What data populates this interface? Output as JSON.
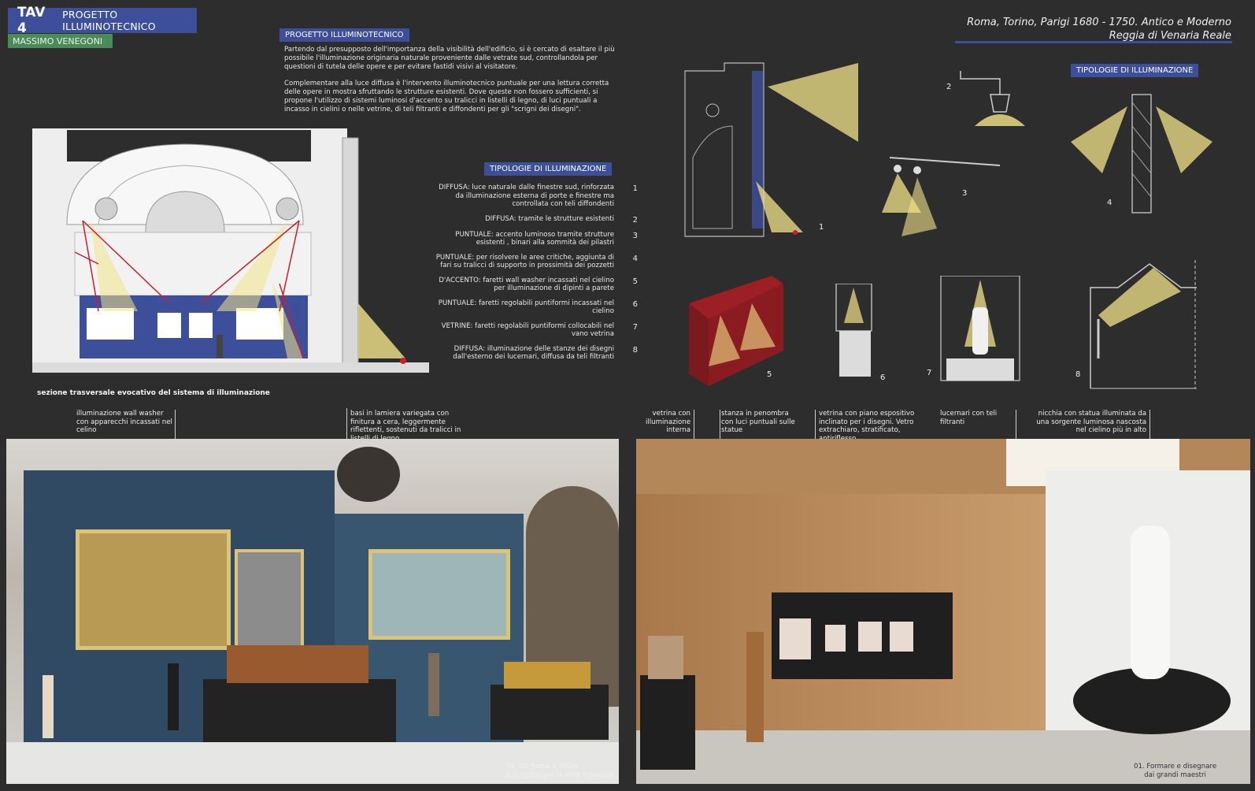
{
  "header": {
    "tav_number": "TAV 4",
    "tav_title": "PROGETTO ILLUMINOTECNICO",
    "author": "MASSIMO VENEGONI",
    "project_line1": "Roma, Torino, Parigi 1680 - 1750. Antico e Moderno",
    "project_line2": "Reggia di Venaria Reale"
  },
  "intro": {
    "heading": "PROGETTO ILLUMINOTECNICO",
    "para1": "Partendo dal presupposto dell'importanza della visibilità dell'edificio, si è cercato di esaltare il più possibile l'illuminazione originaria naturale proveniente dalle vetrate sud, controllandola per questioni di tutela delle opere e per evitare fastidi visivi al visitatore.",
    "para2": "Complementare alla luce diffusa è l'intervento illuminotecnico puntuale per una lettura corretta delle opere in mostra sfruttando le strutture esistenti. Dove queste non fossero sufficienti, si propone l'utilizzo di sistemi luminosi d'accento su tralicci in listelli di legno, di luci puntuali a incasso in cielini o nelle vetrine, di teli filtranti e diffondenti per gli \"scrigni dei disegni\"."
  },
  "legend": {
    "heading": "TIPOLOGIE DI ILLUMINAZIONE",
    "items": [
      {
        "n": "1",
        "text": "DIFFUSA: luce naturale dalle finestre sud, rinforzata da illuminazione esterna di porte e finestre ma controllata con teli diffondenti"
      },
      {
        "n": "2",
        "text": "DIFFUSA: tramite le strutture esistenti"
      },
      {
        "n": "3",
        "text": "PUNTUALE: accento luminoso tramite strutture esistenti , binari alla sommità dei pilastri"
      },
      {
        "n": "4",
        "text": "PUNTUALE: per risolvere le aree critiche, aggiunta di fari su tralicci di supporto in prossimità dei pozzetti"
      },
      {
        "n": "5",
        "text": "D'ACCENTO: faretti wall washer incassati nel cielino per illuminazione di dipinti a parete"
      },
      {
        "n": "6",
        "text": "PUNTUALE: faretti regolabili puntiformi  incassati nel cielino"
      },
      {
        "n": "7",
        "text": "VETRINE: faretti regolabili puntiformi  collocabili nel vano vetrina"
      },
      {
        "n": "8",
        "text": "DIFFUSA: illuminazione delle stanze dei disegni dall'esterno dei lucernari, diffusa da teli filtranti"
      }
    ]
  },
  "section_caption": "sezione trasversale evocativo del sistema di illuminazione",
  "typologies_heading": "TIPOLOGIE DI ILLUMINAZIONE",
  "diagram_numbers": [
    "1",
    "2",
    "3",
    "4",
    "5",
    "6",
    "7",
    "8"
  ],
  "annotations_left": [
    "illuminazione wall washer con apparecchi incassati nel celino",
    "basi in lamiera variegata con finitura a cera, leggermente riflettenti, sostenuti da tralicci in listelli di legno"
  ],
  "annotations_right": [
    "vetrina con illuminazione interna",
    "stanza in penombra con luci puntuali sulle statue",
    "vetrina con piano espositivo inclinato per i disegni.  Vetro extrachiaro, stratificato, antiriflesso",
    "lucernari con teli filtranti",
    "nicchia con  statua illuminata da una sorgente luminosa nascosta nel cielino più in alto"
  ],
  "render_left_caption": [
    "06. Da Roma a Torino",
    "Il progetto per la città moderna"
  ],
  "render_right_caption": [
    "01. Formare e disegnare",
    "dai grandi maestri"
  ],
  "colors": {
    "background": "#2d2d2d",
    "accent_blue": "#3d4f9b",
    "author_green": "#4b8b59",
    "light_beam": "#f3e38a",
    "red_line": "#c8202a"
  }
}
